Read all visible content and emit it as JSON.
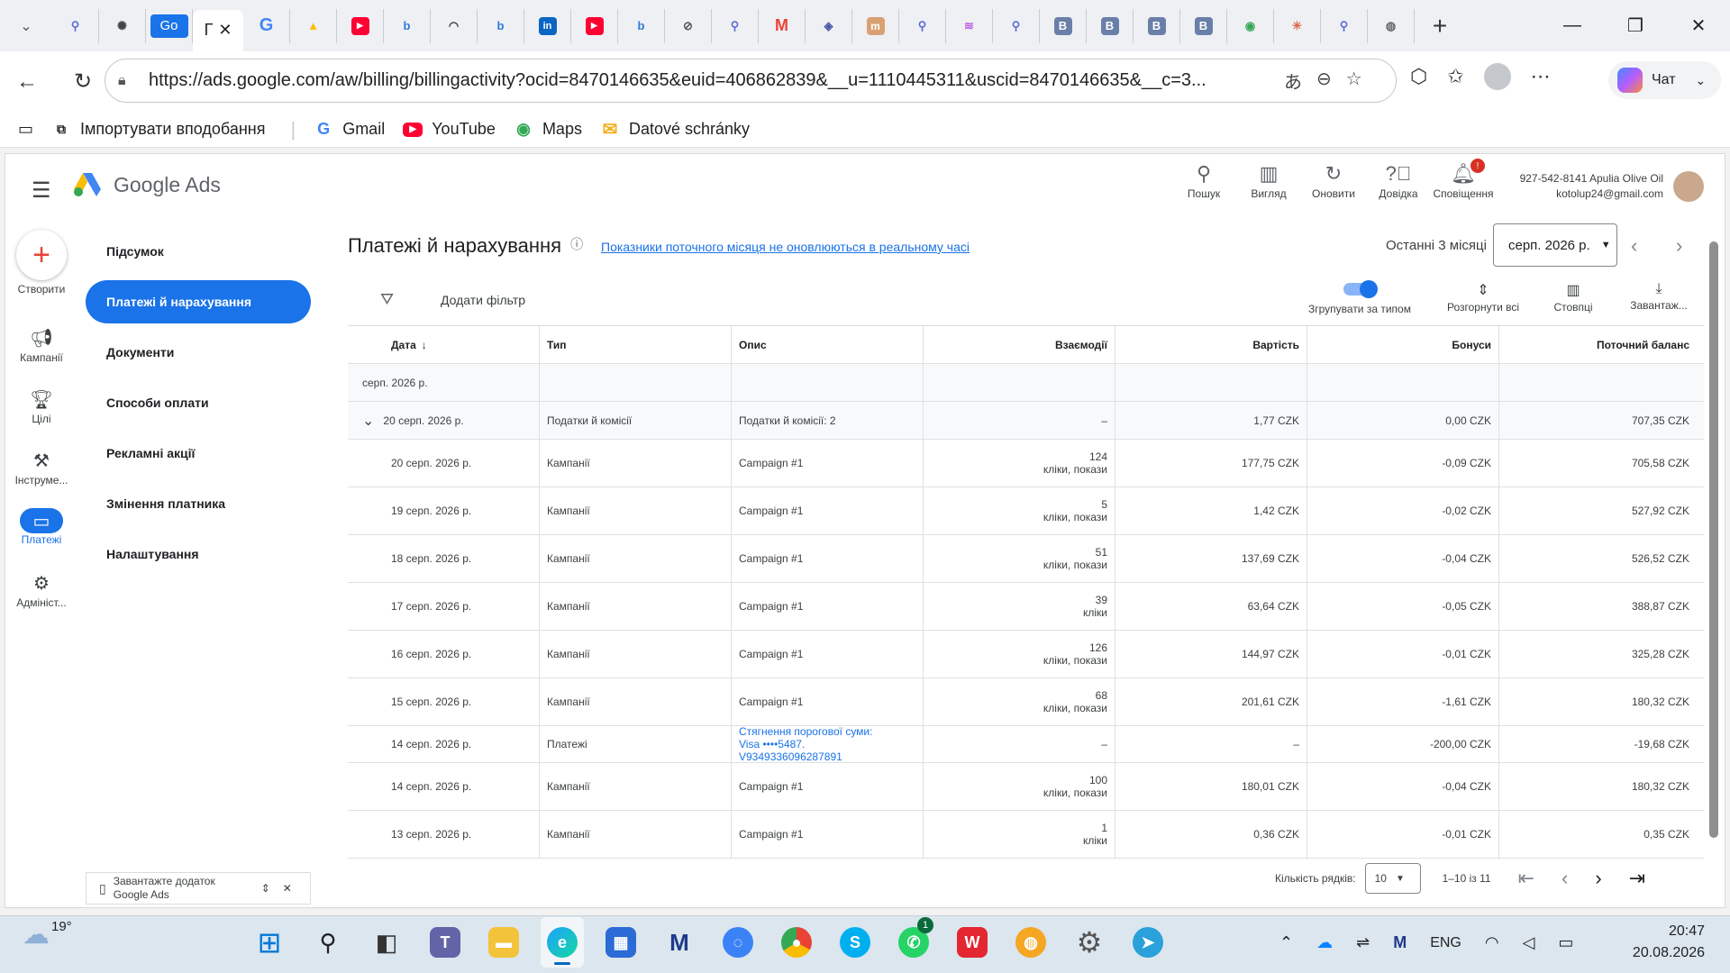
{
  "browser": {
    "active_tab_label": "Г",
    "go_tab_label": "Go",
    "url": "https://ads.google.com/aw/billing/billingactivity?ocid=8470146635&euid=406862839&__u=1110445311&uscid=8470146635&__c=3...",
    "chat_label": "Чат",
    "bookmarks": [
      {
        "label": "Імпортувати вподобання",
        "icon": "import-icon"
      },
      {
        "label": "Gmail",
        "icon": "google-icon"
      },
      {
        "label": "YouTube",
        "icon": "youtube-icon"
      },
      {
        "label": "Maps",
        "icon": "maps-icon"
      },
      {
        "label": "Datové schránky",
        "icon": "folder-icon"
      }
    ]
  },
  "ads": {
    "logo_text": "Google Ads",
    "header_actions": [
      {
        "label": "Пошук",
        "icon": "search-icon"
      },
      {
        "label": "Вигляд",
        "icon": "view-icon"
      },
      {
        "label": "Оновити",
        "icon": "refresh-icon"
      },
      {
        "label": "Довідка",
        "icon": "help-icon"
      },
      {
        "label": "Сповіщення",
        "icon": "bell-icon"
      }
    ],
    "notification_count": "!",
    "account_line1": "927-542-8141 Apulia Olive Oil",
    "account_line2": "kotolup24@gmail.com",
    "rail": [
      {
        "label": "Створити"
      },
      {
        "label": "Кампанії"
      },
      {
        "label": "Цілі"
      },
      {
        "label": "Інструме..."
      },
      {
        "label": "Платежі"
      },
      {
        "label": "Адмініст..."
      }
    ],
    "nav": [
      "Підсумок",
      "Платежі й нарахування",
      "Документи",
      "Способи оплати",
      "Рекламні акції",
      "Змінення платника",
      "Налаштування"
    ],
    "promo_line1": "Завантажте додаток",
    "promo_line2": "Google Ads",
    "page_title": "Платежі й нарахування",
    "notice_link": "Показники поточного місяця не оновлюються в реальному часі",
    "range_label": "Останні 3 місяці",
    "range_value": "серп. 2026 р.",
    "add_filter": "Додати фільтр",
    "toolbar": {
      "group_by_type": "Згрупувати за типом",
      "expand_all": "Розгорнути всі",
      "columns": "Стовпці",
      "download": "Завантаж..."
    },
    "columns": [
      "Дата",
      "Тип",
      "Опис",
      "Взаємодії",
      "Вартість",
      "Бонуси",
      "Поточний баланс"
    ],
    "month_group": "серп. 2026 р.",
    "group_row": {
      "date": "20 серп. 2026 р.",
      "type": "Податки й комісії",
      "desc": "Податки й комісії: 2",
      "inter": "–",
      "cost": "1,77 CZK",
      "bonus": "0,00 CZK",
      "balance": "707,35 CZK"
    },
    "rows": [
      {
        "date": "20 серп. 2026 р.",
        "type": "Кампанії",
        "desc": "Campaign #1",
        "inter_n": "124",
        "inter_t": "кліки, покази",
        "cost": "177,75 CZK",
        "bonus": "-0,09 CZK",
        "balance": "705,58 CZK"
      },
      {
        "date": "19 серп. 2026 р.",
        "type": "Кампанії",
        "desc": "Campaign #1",
        "inter_n": "5",
        "inter_t": "кліки, покази",
        "cost": "1,42 CZK",
        "bonus": "-0,02 CZK",
        "balance": "527,92 CZK"
      },
      {
        "date": "18 серп. 2026 р.",
        "type": "Кампанії",
        "desc": "Campaign #1",
        "inter_n": "51",
        "inter_t": "кліки, покази",
        "cost": "137,69 CZK",
        "bonus": "-0,04 CZK",
        "balance": "526,52 CZK"
      },
      {
        "date": "17 серп. 2026 р.",
        "type": "Кампанії",
        "desc": "Campaign #1",
        "inter_n": "39",
        "inter_t": "кліки",
        "cost": "63,64 CZK",
        "bonus": "-0,05 CZK",
        "balance": "388,87 CZK"
      },
      {
        "date": "16 серп. 2026 р.",
        "type": "Кампанії",
        "desc": "Campaign #1",
        "inter_n": "126",
        "inter_t": "кліки, покази",
        "cost": "144,97 CZK",
        "bonus": "-0,01 CZK",
        "balance": "325,28 CZK"
      },
      {
        "date": "15 серп. 2026 р.",
        "type": "Кампанії",
        "desc": "Campaign #1",
        "inter_n": "68",
        "inter_t": "кліки, покази",
        "cost": "201,61 CZK",
        "bonus": "-1,61 CZK",
        "balance": "180,32 CZK"
      }
    ],
    "payment_row": {
      "date": "14 серп. 2026 р.",
      "type": "Платежі",
      "desc1": "Стягнення порогової суми:",
      "desc2": "Visa ••••5487.",
      "desc3": "V9349336096287891",
      "inter": "–",
      "cost": "–",
      "bonus": "-200,00 CZK",
      "balance": "-19,68 CZK"
    },
    "rows_after": [
      {
        "date": "14 серп. 2026 р.",
        "type": "Кампанії",
        "desc": "Campaign #1",
        "inter_n": "100",
        "inter_t": "кліки, покази",
        "cost": "180,01 CZK",
        "bonus": "-0,04 CZK",
        "balance": "180,32 CZK"
      },
      {
        "date": "13 серп. 2026 р.",
        "type": "Кампанії",
        "desc": "Campaign #1",
        "inter_n": "1",
        "inter_t": "кліки",
        "cost": "0,36 CZK",
        "bonus": "-0,01 CZK",
        "balance": "0,35 CZK"
      }
    ],
    "pager": {
      "rows_label": "Кількість рядків:",
      "rows_value": "10",
      "range": "1–10 із 11"
    }
  },
  "taskbar": {
    "temperature": "19°",
    "lang": "ENG",
    "time": "20:47",
    "date": "20.08.2026",
    "whatsapp_badge": "1"
  }
}
